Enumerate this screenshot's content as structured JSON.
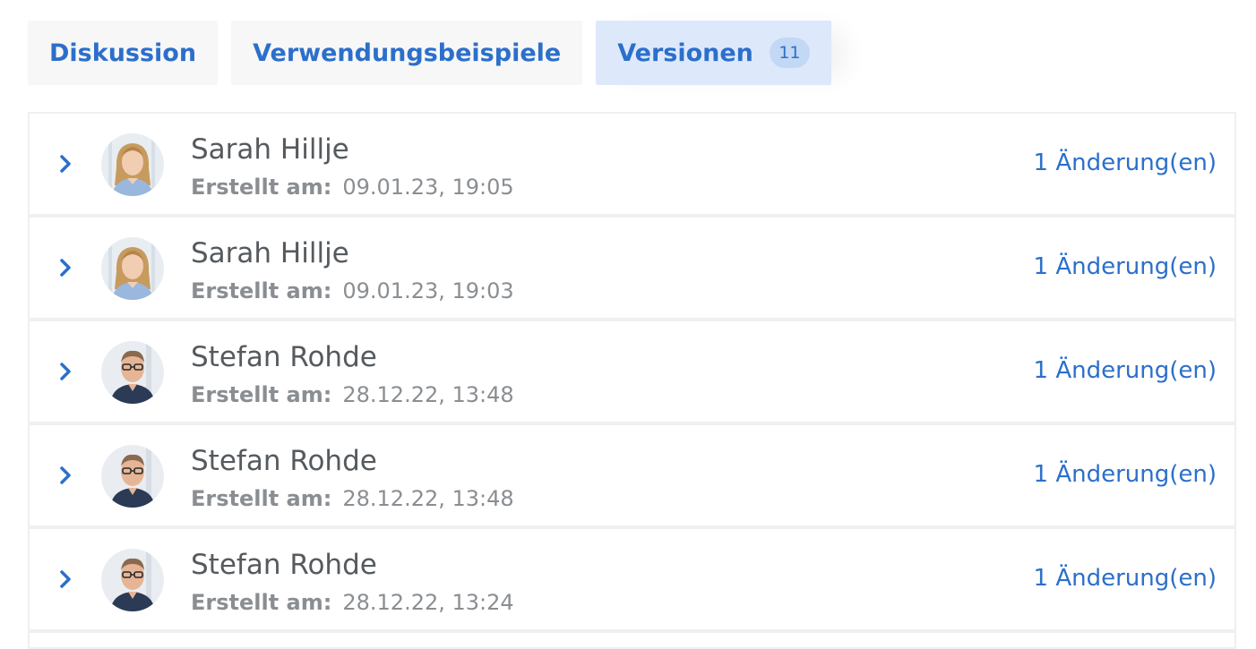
{
  "tabs": [
    {
      "label": "Diskussion",
      "active": false
    },
    {
      "label": "Verwendungsbeispiele",
      "active": false
    },
    {
      "label": "Versionen",
      "active": true,
      "count": "11"
    }
  ],
  "versions": {
    "created_label": "Erstellt am:",
    "items": [
      {
        "author": "Sarah Hillje",
        "date": "09.01.23, 19:05",
        "changes": "1 Änderung(en)",
        "avatar": "sarah"
      },
      {
        "author": "Sarah Hillje",
        "date": "09.01.23, 19:03",
        "changes": "1 Änderung(en)",
        "avatar": "sarah"
      },
      {
        "author": "Stefan Rohde",
        "date": "28.12.22, 13:48",
        "changes": "1 Änderung(en)",
        "avatar": "stefan"
      },
      {
        "author": "Stefan Rohde",
        "date": "28.12.22, 13:48",
        "changes": "1 Änderung(en)",
        "avatar": "stefan"
      },
      {
        "author": "Stefan Rohde",
        "date": "28.12.22, 13:24",
        "changes": "1 Änderung(en)",
        "avatar": "stefan"
      }
    ]
  },
  "colors": {
    "accent": "#2c6fcb",
    "active_tab_bg": "#dde9fb",
    "tab_bg": "#f7f7f7",
    "text_dark": "#555a5e",
    "text_muted": "#8a8e92"
  }
}
